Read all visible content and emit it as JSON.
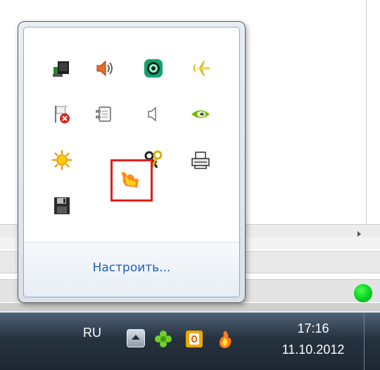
{
  "notification_area": {
    "customize_link": "Настроить...",
    "icons": [
      {
        "name": "network-icon"
      },
      {
        "name": "volume-icon"
      },
      {
        "name": "green-circle-app-icon"
      },
      {
        "name": "airplane-icon"
      },
      {
        "name": "action-center-error-icon"
      },
      {
        "name": "power-plug-icon"
      },
      {
        "name": "muted-speaker-icon"
      },
      {
        "name": "nvidia-icon"
      },
      {
        "name": "sun-icon"
      },
      {
        "name": "flame-app-icon"
      },
      {
        "name": "keys-icon"
      },
      {
        "name": "printer-icon"
      },
      {
        "name": "floppy-disk-icon"
      }
    ],
    "highlighted_icon": "flame-app-icon",
    "highlight_color": "#e0201e"
  },
  "taskbar": {
    "language": "RU",
    "time": "17:16",
    "date": "11.10.2012",
    "tray_icons": [
      "show-hidden-icons-button",
      "clover-icon",
      "office-icon",
      "flame-icon"
    ]
  },
  "colors": {
    "link": "#1e5fb4",
    "taskbar": "#26323f",
    "status_dot": "#00cc22"
  }
}
